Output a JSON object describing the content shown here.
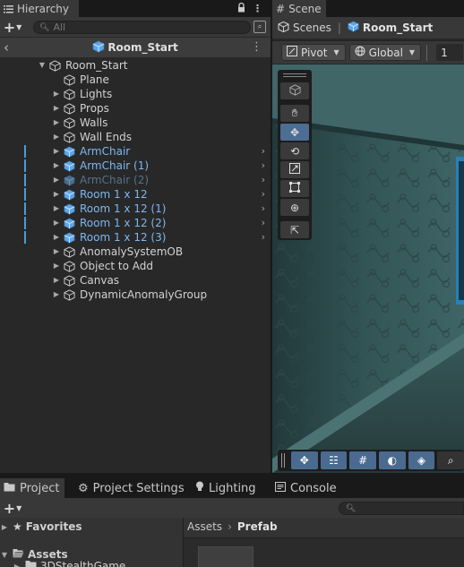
{
  "colors": {
    "prefab_text": "#7fb7ef",
    "prefab_inactive_text": "#56718e",
    "accent_blue": "#4c6d94",
    "panel_bg": "#282828"
  },
  "hierarchy": {
    "tab_label": "Hierarchy",
    "tab_icon": "list-icon",
    "search_placeholder": "All",
    "breadcrumb_title": "Room_Start",
    "items": [
      {
        "label": "Room_Start",
        "depth": 0,
        "expanded": true,
        "arrow": "▼",
        "prefab": false,
        "inactive": false,
        "marked": false,
        "has_children_arrow": false
      },
      {
        "label": "Plane",
        "depth": 1,
        "expanded": false,
        "arrow": "",
        "prefab": false,
        "inactive": false,
        "marked": false,
        "has_children_arrow": false
      },
      {
        "label": "Lights",
        "depth": 1,
        "expanded": false,
        "arrow": "▶",
        "prefab": false,
        "inactive": false,
        "marked": false,
        "has_children_arrow": false
      },
      {
        "label": "Props",
        "depth": 1,
        "expanded": false,
        "arrow": "▶",
        "prefab": false,
        "inactive": false,
        "marked": false,
        "has_children_arrow": false
      },
      {
        "label": "Walls",
        "depth": 1,
        "expanded": false,
        "arrow": "▶",
        "prefab": false,
        "inactive": false,
        "marked": false,
        "has_children_arrow": false
      },
      {
        "label": "Wall Ends",
        "depth": 1,
        "expanded": false,
        "arrow": "▶",
        "prefab": false,
        "inactive": false,
        "marked": false,
        "has_children_arrow": false
      },
      {
        "label": "ArmChair",
        "depth": 1,
        "expanded": false,
        "arrow": "▶",
        "prefab": true,
        "inactive": false,
        "marked": true,
        "has_children_arrow": true
      },
      {
        "label": "ArmChair (1)",
        "depth": 1,
        "expanded": false,
        "arrow": "▶",
        "prefab": true,
        "inactive": false,
        "marked": true,
        "has_children_arrow": true
      },
      {
        "label": "ArmChair (2)",
        "depth": 1,
        "expanded": false,
        "arrow": "▶",
        "prefab": true,
        "inactive": true,
        "marked": true,
        "has_children_arrow": true
      },
      {
        "label": "Room 1 x 12",
        "depth": 1,
        "expanded": false,
        "arrow": "▶",
        "prefab": true,
        "inactive": false,
        "marked": true,
        "has_children_arrow": true
      },
      {
        "label": "Room 1 x 12 (1)",
        "depth": 1,
        "expanded": false,
        "arrow": "▶",
        "prefab": true,
        "inactive": false,
        "marked": true,
        "has_children_arrow": true
      },
      {
        "label": "Room 1 x 12 (2)",
        "depth": 1,
        "expanded": false,
        "arrow": "▶",
        "prefab": true,
        "inactive": false,
        "marked": true,
        "has_children_arrow": true
      },
      {
        "label": "Room 1 x 12 (3)",
        "depth": 1,
        "expanded": false,
        "arrow": "▶",
        "prefab": true,
        "inactive": false,
        "marked": true,
        "has_children_arrow": true
      },
      {
        "label": "AnomalySystemOB",
        "depth": 1,
        "expanded": false,
        "arrow": "▶",
        "prefab": false,
        "inactive": false,
        "marked": false,
        "has_children_arrow": false
      },
      {
        "label": "Object to Add",
        "depth": 1,
        "expanded": false,
        "arrow": "▶",
        "prefab": false,
        "inactive": false,
        "marked": false,
        "has_children_arrow": false
      },
      {
        "label": "Canvas",
        "depth": 1,
        "expanded": false,
        "arrow": "▶",
        "prefab": false,
        "inactive": false,
        "marked": false,
        "has_children_arrow": false
      },
      {
        "label": "DynamicAnomalyGroup",
        "depth": 1,
        "expanded": false,
        "arrow": "▶",
        "prefab": false,
        "inactive": false,
        "marked": false,
        "has_children_arrow": false
      }
    ]
  },
  "scene": {
    "tab_label": "Scene",
    "tab_icon": "hash-icon",
    "breadcrumb_root": "Scenes",
    "breadcrumb_current": "Room_Start",
    "pivot_label": "Pivot",
    "global_label": "Global",
    "grid_value": "1",
    "tools": [
      "view-tool-icon",
      "hand-tool-icon",
      "move-tool-icon",
      "rotate-tool-icon",
      "scale-tool-icon",
      "rect-tool-icon",
      "transform-tool-icon",
      "custom-tool-icon"
    ],
    "active_tool": "move-tool-icon",
    "overlay_buttons": [
      "move-gizmo-icon",
      "component-tools-icon",
      "grid-snap-icon",
      "lighting-toggle-icon",
      "gizmo-toggle-icon",
      "search-icon"
    ]
  },
  "bottom": {
    "tabs": [
      {
        "label": "Project",
        "icon": "folder-icon",
        "active": true
      },
      {
        "label": "Project Settings",
        "icon": "gear-icon",
        "active": false
      },
      {
        "label": "Lighting",
        "icon": "bulb-icon",
        "active": false
      },
      {
        "label": "Console",
        "icon": "console-icon",
        "active": false
      }
    ],
    "tree": {
      "favorites_label": "Favorites",
      "assets_label": "Assets",
      "child_label": "3DStealthGame"
    },
    "breadcrumb_root": "Assets",
    "breadcrumb_current": "Prefab"
  }
}
